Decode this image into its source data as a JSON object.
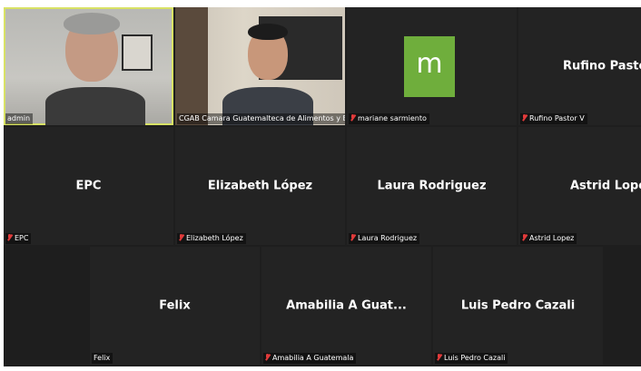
{
  "participants": [
    {
      "name": "admin",
      "label": "admin",
      "muted": false,
      "video": true,
      "active": true
    },
    {
      "name": "CGAB Camara Guatemalteca de Alimentos y Bebidas",
      "label": "CGAB Camara Guatemalteca de Alimentos y Bebidas",
      "muted": false,
      "video": true
    },
    {
      "name": "",
      "avatar_letter": "m",
      "label": "mariane sarmiento",
      "muted": true,
      "avatar_color": "#6fae3c"
    },
    {
      "name": "Rufino Pastor V",
      "label": "Rufino Pastor V",
      "muted": true
    },
    {
      "name": "EPC",
      "label": "EPC",
      "muted": true
    },
    {
      "name": "Elizabeth López",
      "label": "Elizabeth López",
      "muted": true
    },
    {
      "name": "Laura Rodriguez",
      "label": "Laura Rodriguez",
      "muted": true
    },
    {
      "name": "Astrid Lopez",
      "label": "Astrid Lopez",
      "muted": true
    },
    {
      "name": "Felix",
      "label": "Felix",
      "muted": false
    },
    {
      "name": "Amabilia A Guat...",
      "label": "Amabilia A Guatemala",
      "muted": true
    },
    {
      "name": "Luis Pedro Cazali",
      "label": "Luis Pedro Cazali",
      "muted": true
    }
  ],
  "colors": {
    "background": "#1e1e1e",
    "tile": "#232323",
    "active_border": "#d8e265",
    "muted_icon": "#e23b3b"
  }
}
